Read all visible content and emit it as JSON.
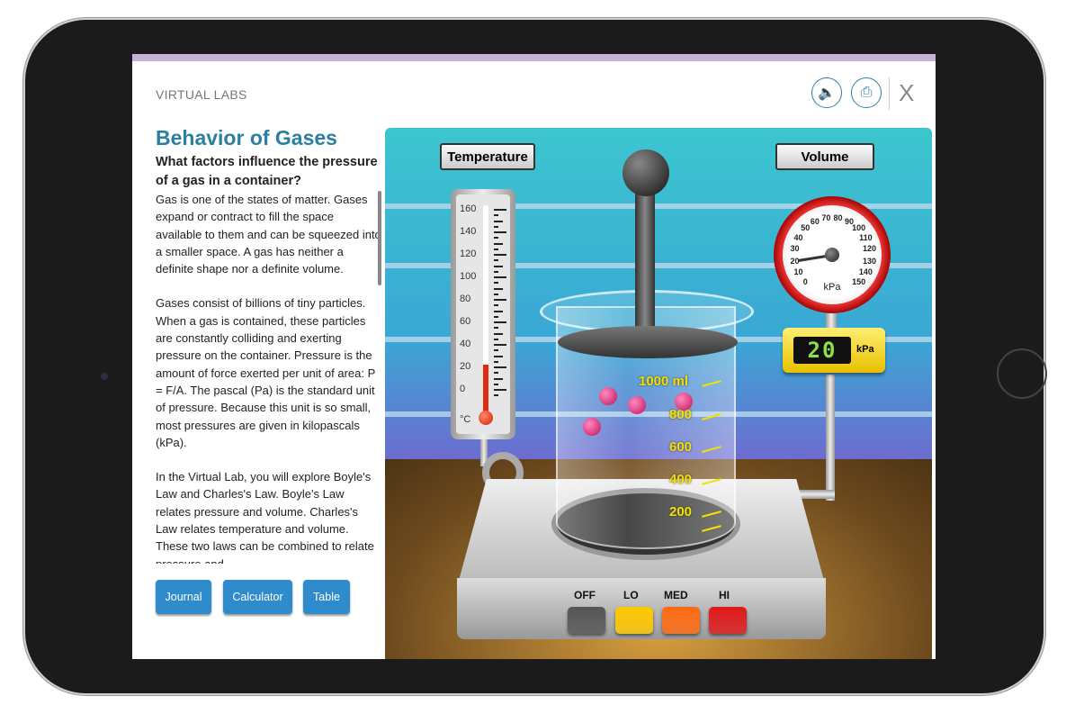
{
  "header": {
    "app_title": "VIRTUAL LABS",
    "icons": [
      "speaker-icon",
      "print-icon"
    ],
    "close_label": "X"
  },
  "content": {
    "title": "Behavior of Gases",
    "question": "What factors influence the pressure of a gas in a container?",
    "paragraphs": [
      "Gas is one of the states of matter. Gases expand or contract to fill the space available to them and can be squeezed into a smaller space. A gas has neither a definite shape nor a definite volume.",
      "Gases consist of billions of tiny particles. When a gas is contained, these particles are constantly colliding and exerting pressure on the container. Pressure is the amount of force exerted per unit of area: P = F/A. The pascal (Pa) is the standard unit of pressure. Because this unit is so small, most pressures are given in kilopascals (kPa).",
      "In the Virtual Lab, you will explore Boyle's Law and Charles's Law. Boyle's Law relates pressure and volume. Charles's Law relates temperature and volume. These two laws can be combined to relate pressure and"
    ],
    "buttons": {
      "journal": "Journal",
      "calculator": "Calculator",
      "table": "Table"
    }
  },
  "lab": {
    "temperature_button": "Temperature",
    "volume_button": "Volume",
    "thermometer": {
      "labels": [
        "160",
        "140",
        "120",
        "100",
        "80",
        "60",
        "40",
        "20",
        "0"
      ],
      "unit": "°C",
      "value_c": 22
    },
    "gauge": {
      "labels": [
        "0",
        "10",
        "20",
        "30",
        "40",
        "50",
        "60",
        "70",
        "80",
        "90",
        "100",
        "110",
        "120",
        "130",
        "140",
        "150"
      ],
      "unit": "kPa",
      "value_kpa": 20
    },
    "readout": {
      "value": "20",
      "unit": "kPa"
    },
    "beaker": {
      "labels": [
        "1000 ml",
        "800",
        "600",
        "400",
        "200"
      ]
    },
    "heater": {
      "labels": [
        "OFF",
        "LO",
        "MED",
        "HI"
      ],
      "colors": [
        "#555555",
        "#ffc800",
        "#ff6a10",
        "#e01818"
      ]
    },
    "particle_color": "#d01868"
  }
}
